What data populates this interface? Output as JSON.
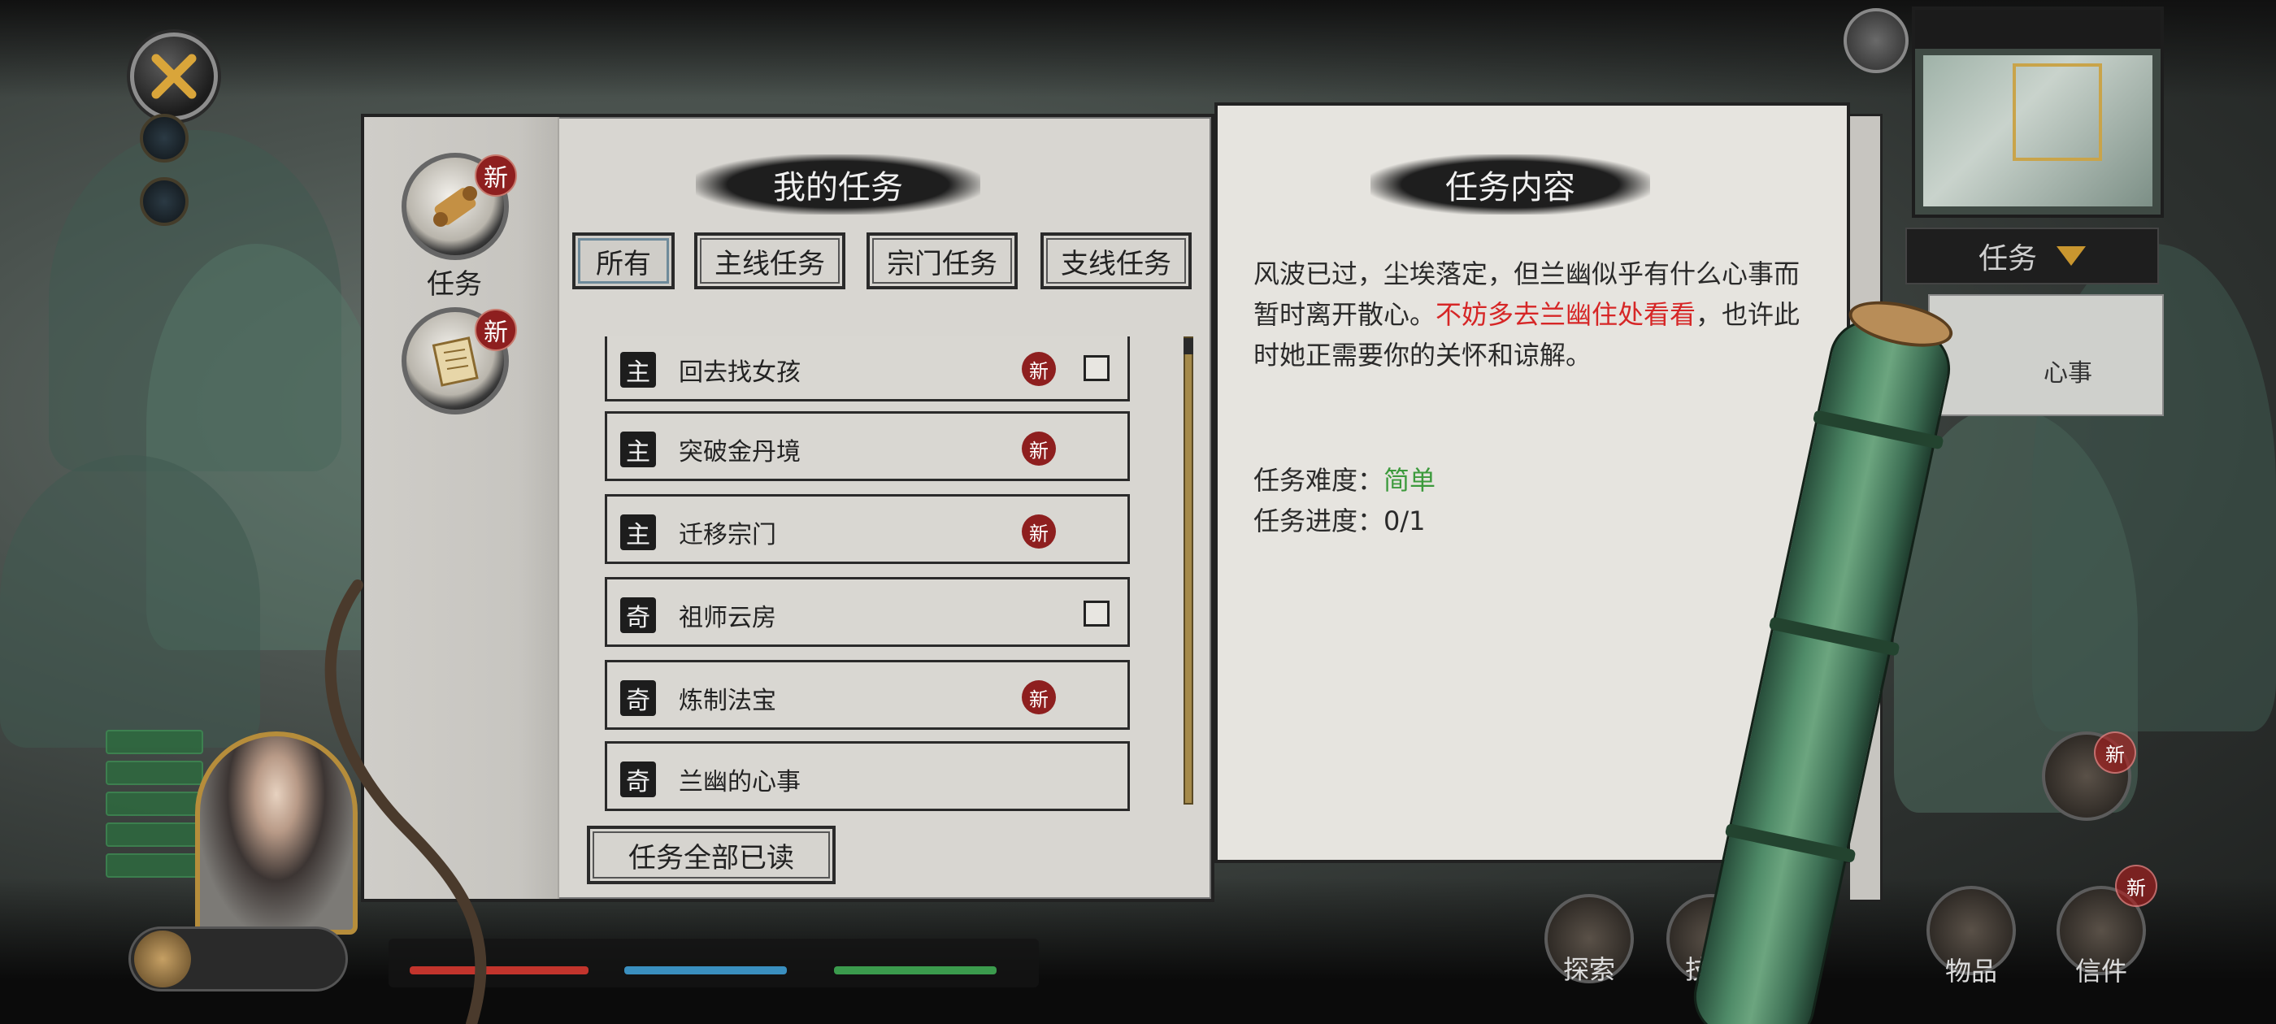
{
  "sidebar": {
    "tab_task_label": "任务",
    "new_badge": "新"
  },
  "task_list_panel": {
    "title": "我的任务",
    "filters": [
      "所有",
      "主线任务",
      "宗门任务",
      "支线任务"
    ],
    "active_filter": "所有",
    "quests": [
      {
        "type": "主",
        "name": "回去找女孩",
        "is_new": true,
        "checkbox": true
      },
      {
        "type": "主",
        "name": "突破金丹境",
        "is_new": true,
        "checkbox": false
      },
      {
        "type": "主",
        "name": "迁移宗门",
        "is_new": true,
        "checkbox": false
      },
      {
        "type": "奇",
        "name": "祖师云房",
        "is_new": false,
        "checkbox": true
      },
      {
        "type": "奇",
        "name": "炼制法宝",
        "is_new": true,
        "checkbox": false
      },
      {
        "type": "奇",
        "name": "兰幽的心事",
        "is_new": false,
        "checkbox": false
      }
    ],
    "read_all_label": "任务全部已读",
    "new_label": "新"
  },
  "detail_panel": {
    "title": "任务内容",
    "description_normal_1": "风波已过，尘埃落定，但兰幽似乎有什么心事而暂时离开散心。",
    "description_highlight": "不妨多去兰幽住处看看",
    "description_normal_2": "，也许此时她正需要你的关怀和谅解。",
    "difficulty_label": "任务难度：",
    "difficulty_value": "简单",
    "progress_label": "任务进度：",
    "progress_value": "0/1"
  },
  "hud": {
    "task_dropdown_label": "任务",
    "task_card_text": "心事",
    "menu_items": [
      "探索",
      "技能",
      "物品",
      "信件"
    ],
    "new_label": "新"
  },
  "colors": {
    "highlight_red": "#d62626",
    "difficulty_green": "#3c9a3c",
    "new_badge_red": "#8e1f1f"
  }
}
